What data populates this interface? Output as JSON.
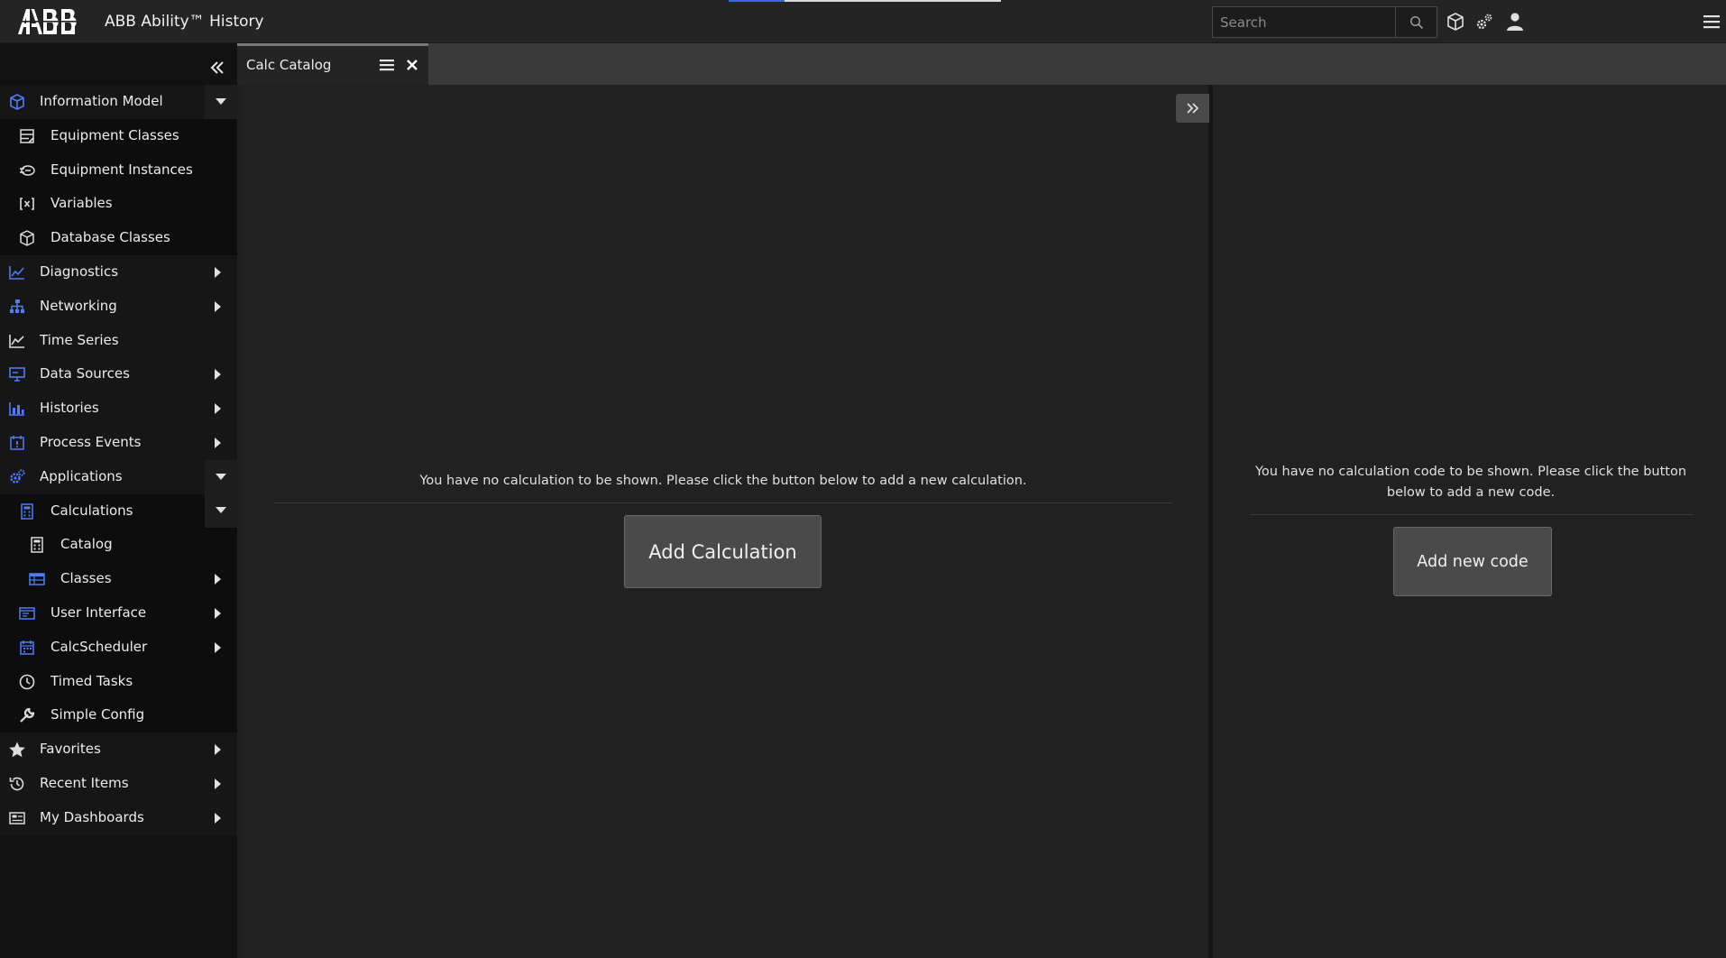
{
  "header": {
    "title": "ABB Ability™ History",
    "search_placeholder": "Search",
    "icons": [
      "search-icon",
      "cube-icon",
      "settings-gears-icon",
      "user-icon",
      "hamburger-menu-icon"
    ]
  },
  "sidebar": {
    "collapse_icon": "double-chevron-left-icon",
    "items": [
      {
        "label": "Information Model",
        "level": 0,
        "icon": "cube-icon",
        "state": "expanded"
      },
      {
        "label": "Equipment Classes",
        "level": 1,
        "icon": "equipment-classes-icon"
      },
      {
        "label": "Equipment Instances",
        "level": 1,
        "icon": "equipment-instances-icon"
      },
      {
        "label": "Variables",
        "level": 1,
        "icon": "variables-icon"
      },
      {
        "label": "Database Classes",
        "level": 1,
        "icon": "cube-outline-icon"
      },
      {
        "label": "Diagnostics",
        "level": 0,
        "icon": "diagnostics-chart-icon",
        "state": "collapsed"
      },
      {
        "label": "Networking",
        "level": 0,
        "icon": "network-icon",
        "state": "collapsed"
      },
      {
        "label": "Time Series",
        "level": 0,
        "icon": "line-chart-icon"
      },
      {
        "label": "Data Sources",
        "level": 0,
        "icon": "monitor-icon",
        "state": "collapsed"
      },
      {
        "label": "Histories",
        "level": 0,
        "icon": "bar-chart-icon",
        "state": "collapsed"
      },
      {
        "label": "Process Events",
        "level": 0,
        "icon": "calendar-alert-icon",
        "state": "collapsed"
      },
      {
        "label": "Applications",
        "level": 0,
        "icon": "gears-icon",
        "state": "expanded"
      },
      {
        "label": "Calculations",
        "level": 1,
        "icon": "calculator-icon",
        "state": "expanded"
      },
      {
        "label": "Catalog",
        "level": 2,
        "icon": "calculator-catalog-icon"
      },
      {
        "label": "Classes",
        "level": 2,
        "icon": "table-icon",
        "state": "collapsed"
      },
      {
        "label": "User Interface",
        "level": 1,
        "icon": "user-interface-icon",
        "state": "collapsed"
      },
      {
        "label": "CalcScheduler",
        "level": 1,
        "icon": "calendar-icon",
        "state": "collapsed"
      },
      {
        "label": "Timed Tasks",
        "level": 1,
        "icon": "clock-icon"
      },
      {
        "label": "Simple Config",
        "level": 1,
        "icon": "wrench-icon"
      },
      {
        "label": "Favorites",
        "level": 0,
        "icon": "star-icon",
        "state": "collapsed"
      },
      {
        "label": "Recent Items",
        "level": 0,
        "icon": "history-icon",
        "state": "collapsed"
      },
      {
        "label": "My Dashboards",
        "level": 0,
        "icon": "dashboard-icon",
        "state": "collapsed"
      }
    ]
  },
  "tabs": [
    {
      "label": "Calc Catalog",
      "active": true
    }
  ],
  "main": {
    "left_empty_message": "You have no calculation to be shown. Please click the button below to add a new calculation.",
    "add_calculation_label": "Add Calculation",
    "right_empty_message": "You have no calculation code to be shown. Please click the button below to add a new code.",
    "add_code_label": "Add new code"
  },
  "colors": {
    "accent_blue": "#3366ff",
    "header_bg": "#242424",
    "sidebar_bg": "#111111",
    "pane_bg": "#212121",
    "button_bg": "#4a4a4a"
  }
}
